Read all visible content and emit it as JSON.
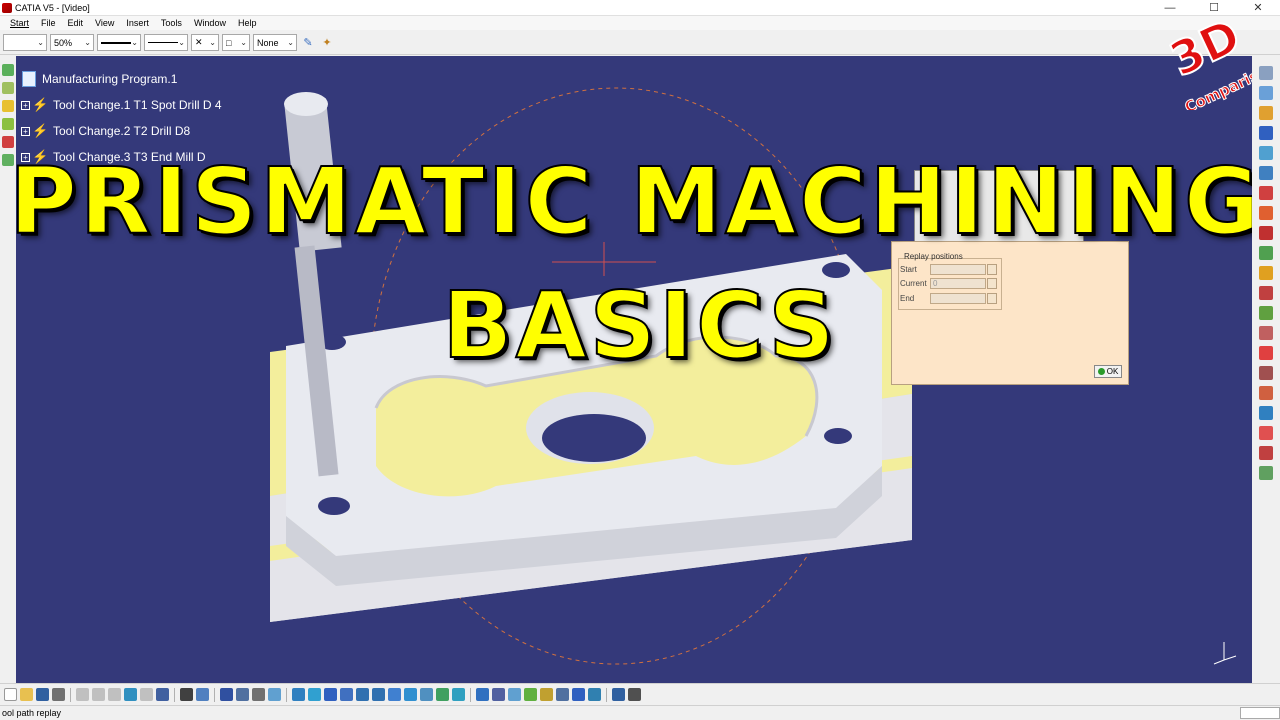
{
  "window": {
    "title": "CATIA V5 - [Video]",
    "controls": [
      "—",
      "☐",
      "✕"
    ]
  },
  "menu": {
    "items": [
      "Start",
      "File",
      "Edit",
      "View",
      "Insert",
      "Tools",
      "Window",
      "Help"
    ]
  },
  "toolbar": {
    "zoom_value": "50%",
    "layer_value": "None",
    "pattern_value": "□"
  },
  "tree": {
    "root": "Manufacturing Program.1",
    "children": [
      "Tool Change.1  T1 Spot Drill D 4",
      "Tool Change.2  T2 Drill D8",
      "Tool Change.3  T3 End Mill D"
    ]
  },
  "dialog": {
    "group_title": "Replay positions",
    "start_label": "Start",
    "current_label": "Current",
    "current_value": "0",
    "end_label": "End",
    "ok_label": "OK"
  },
  "headline": {
    "line1": "PRISMATIC MACHINING",
    "line2": "BASICS"
  },
  "logo": {
    "big": "3D",
    "small": "Comparison",
    "color": "#e01010"
  },
  "statusbar": {
    "text": "ool path replay"
  },
  "colors": {
    "viewport_bg": "#34397a",
    "headline": "#ffff00",
    "part_top": "#e6e8f0",
    "part_yellow": "#f3ee9c",
    "dialog_bg": "#fde5c8"
  }
}
